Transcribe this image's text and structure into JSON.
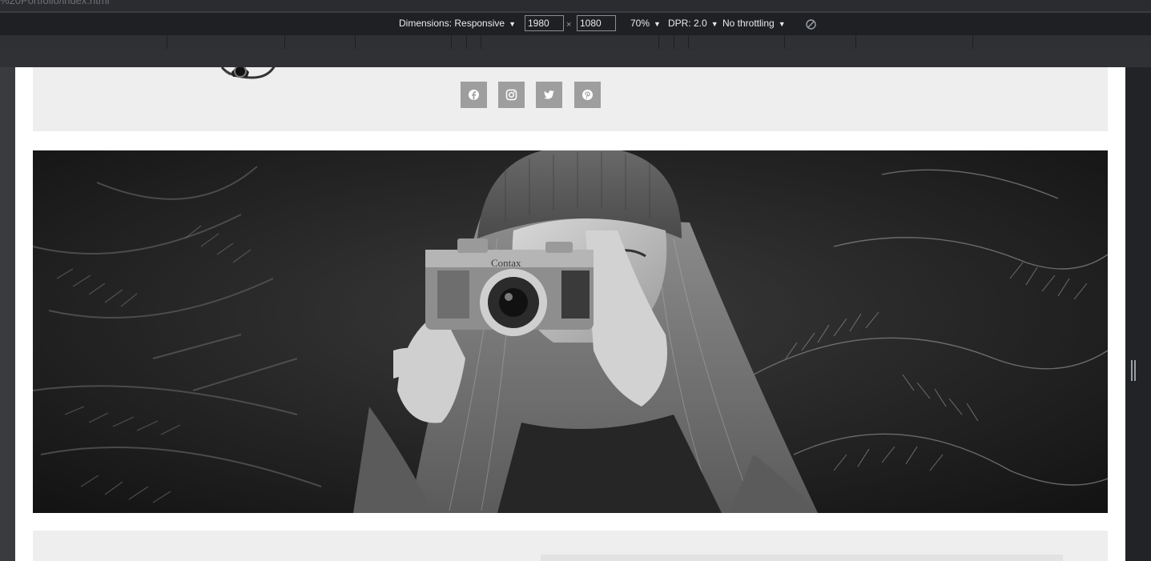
{
  "browser": {
    "url_fragment": "%20Portfolio/index.html"
  },
  "device_toolbar": {
    "dimensions_label": "Dimensions: Responsive",
    "width_value": "1980",
    "height_value": "1080",
    "times_symbol": "×",
    "zoom": "70%",
    "dpr": "DPR: 2.0",
    "throttling": "No throttling",
    "caret": "▼"
  },
  "page": {
    "social_links": [
      {
        "icon": "facebook-icon"
      },
      {
        "icon": "instagram-icon"
      },
      {
        "icon": "twitter-icon"
      },
      {
        "icon": "pinterest-icon"
      }
    ],
    "hero": {
      "camera_brand": "Contax",
      "tone": "black-and-white"
    }
  },
  "colors": {
    "devtools_bg": "#1f2023",
    "page_panel": "#eeeeee",
    "social_button": "#9e9e9e"
  }
}
